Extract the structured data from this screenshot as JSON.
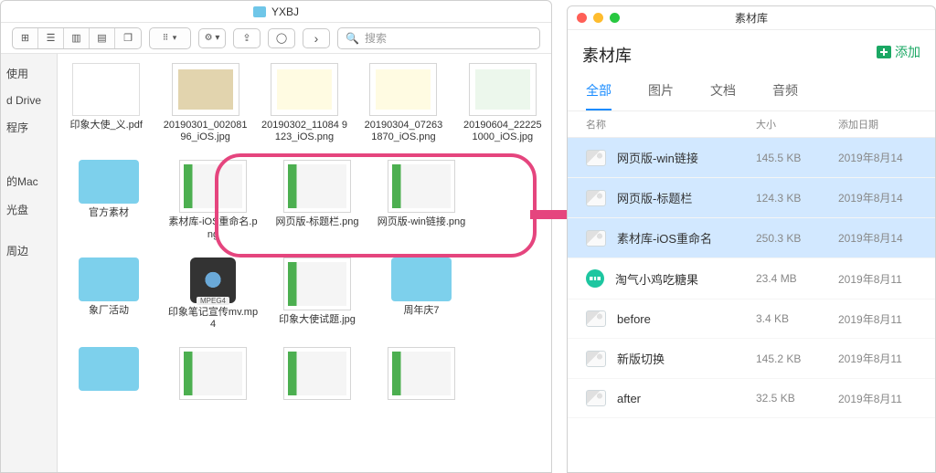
{
  "finder": {
    "title": "YXBJ",
    "search_placeholder": "搜索",
    "sidebar": [
      "使用",
      "d Drive",
      "程序",
      "",
      "",
      "的Mac",
      "光盘",
      "",
      "周边"
    ],
    "rows": [
      [
        {
          "name": "印象大使_义.pdf",
          "cls": "pdf"
        },
        {
          "name": "20190301_00208196_iOS.jpg",
          "cls": "jpg"
        },
        {
          "name": "20190302_11084 9123_iOS.png",
          "cls": "png"
        },
        {
          "name": "20190304_07263 1870_iOS.png",
          "cls": "png"
        },
        {
          "name": "20190604_22225 1000_iOS.jpg",
          "cls": "png2"
        }
      ],
      [
        {
          "name": "官方素材",
          "cls": "folder"
        },
        {
          "name": "素材库-iOS重命名.png",
          "cls": "shot"
        },
        {
          "name": "网页版-标题栏.png",
          "cls": "shot"
        },
        {
          "name": "网页版-win链接.png",
          "cls": "shot"
        }
      ],
      [
        {
          "name": "象厂活动",
          "cls": "folder"
        },
        {
          "name": "印象笔记宣传mv.mp4",
          "cls": "mp4"
        },
        {
          "name": "印象大使试题.jpg",
          "cls": "shot"
        },
        {
          "name": "周年庆7",
          "cls": "folder"
        }
      ],
      [
        {
          "name": "",
          "cls": "folder"
        },
        {
          "name": "",
          "cls": "shot"
        },
        {
          "name": "",
          "cls": "shot"
        },
        {
          "name": "",
          "cls": "shot"
        }
      ]
    ],
    "mp4_tag": "MPEG4"
  },
  "panel": {
    "window_title": "素材库",
    "header": "素材库",
    "add_label": "添加",
    "tabs": [
      "全部",
      "图片",
      "文档",
      "音频"
    ],
    "active_tab": 0,
    "columns": {
      "name": "名称",
      "size": "大小",
      "date": "添加日期"
    },
    "items": [
      {
        "name": "网页版-win链接",
        "size": "145.5 KB",
        "date": "2019年8月14",
        "sel": true,
        "icon": "img"
      },
      {
        "name": "网页版-标题栏",
        "size": "124.3 KB",
        "date": "2019年8月14",
        "sel": true,
        "icon": "img"
      },
      {
        "name": "素材库-iOS重命名",
        "size": "250.3 KB",
        "date": "2019年8月14",
        "sel": true,
        "icon": "img"
      },
      {
        "name": "淘气小鸡吃糖果",
        "size": "23.4 MB",
        "date": "2019年8月11",
        "sel": false,
        "icon": "audio"
      },
      {
        "name": "before",
        "size": "3.4 KB",
        "date": "2019年8月11",
        "sel": false,
        "icon": "img"
      },
      {
        "name": "新版切换",
        "size": "145.2 KB",
        "date": "2019年8月11",
        "sel": false,
        "icon": "img"
      },
      {
        "name": "after",
        "size": "32.5 KB",
        "date": "2019年8月11",
        "sel": false,
        "icon": "img"
      }
    ]
  }
}
